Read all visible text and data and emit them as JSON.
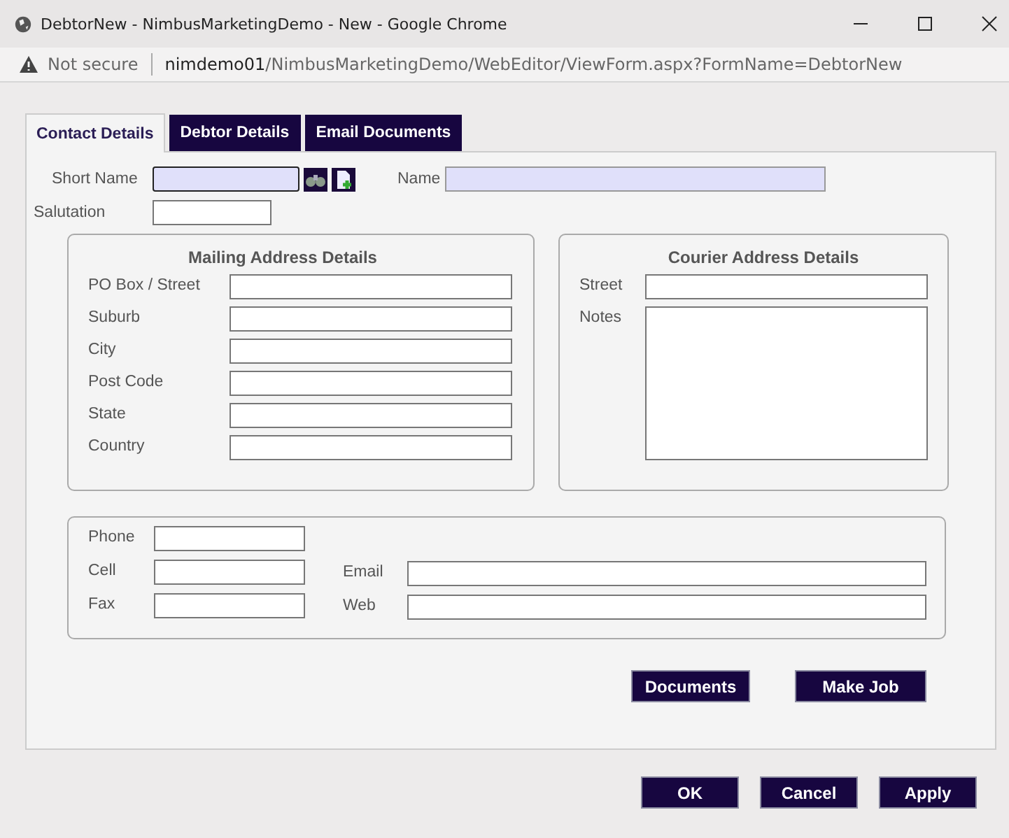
{
  "window": {
    "title": "DebtorNew - NimbusMarketingDemo - New - Google Chrome"
  },
  "address_bar": {
    "security": "Not secure",
    "host": "nimdemo01",
    "path": "/NimbusMarketingDemo/WebEditor/ViewForm.aspx?FormName=DebtorNew"
  },
  "tabs": [
    {
      "label": "Contact Details",
      "selected": true
    },
    {
      "label": "Debtor Details",
      "selected": false
    },
    {
      "label": "Email Documents",
      "selected": false
    }
  ],
  "header": {
    "short_name_label": "Short Name",
    "name_label": "Name",
    "salutation_label": "Salutation"
  },
  "mailing": {
    "title": "Mailing Address Details",
    "fields": [
      "PO Box / Street",
      "Suburb",
      "City",
      "Post Code",
      "State",
      "Country"
    ]
  },
  "courier": {
    "title": "Courier Address Details",
    "fields": [
      {
        "label": "Street",
        "kind": "input"
      },
      {
        "label": "Notes",
        "kind": "textarea"
      }
    ]
  },
  "contact": {
    "left": [
      "Phone",
      "Cell",
      "Fax"
    ],
    "right": [
      "Email",
      "Web"
    ]
  },
  "actions": [
    "Documents",
    "Make Job"
  ],
  "dialog_buttons": [
    "OK",
    "Cancel",
    "Apply"
  ]
}
